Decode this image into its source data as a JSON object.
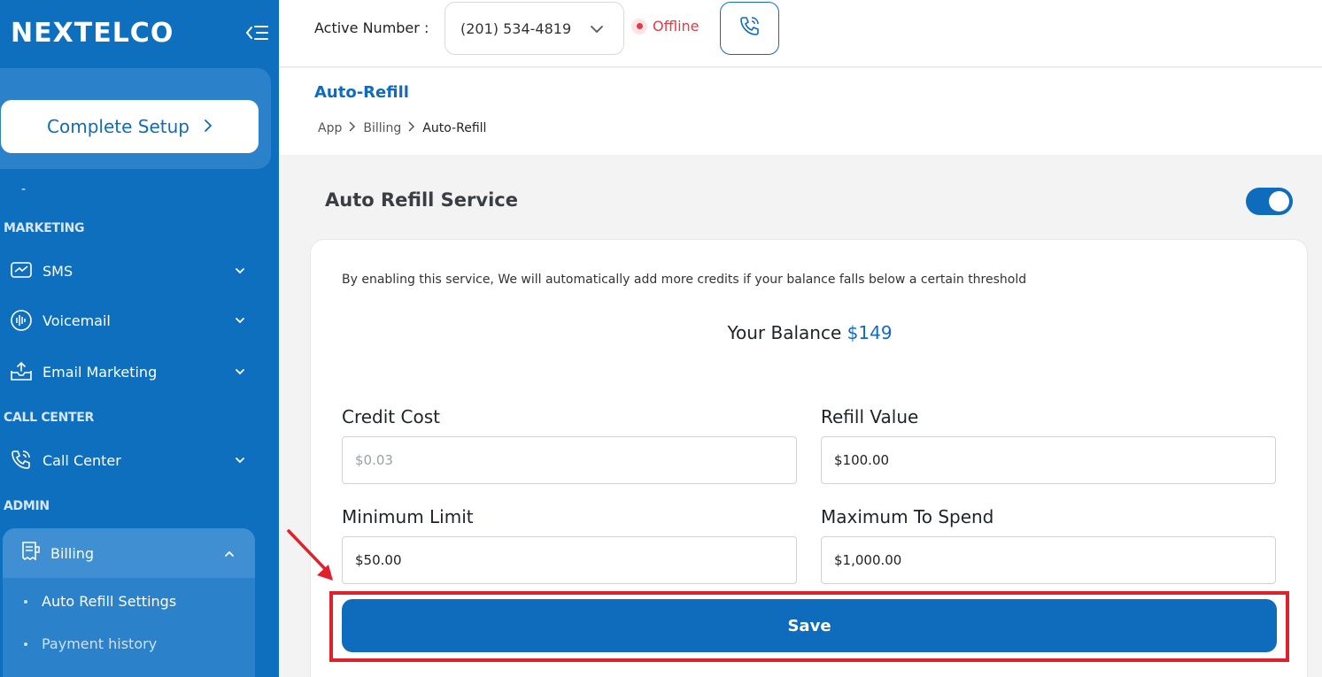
{
  "brand": {
    "logo_text": "NEXTELCO"
  },
  "sidebar": {
    "setup_button": "Complete Setup",
    "dash": "-",
    "sections": {
      "marketing": "MARKETING",
      "call_center": "CALL CENTER",
      "admin": "ADMIN"
    },
    "items": {
      "sms": "SMS",
      "voicemail": "Voicemail",
      "email_marketing": "Email Marketing",
      "call_center": "Call Center",
      "billing": "Billing"
    },
    "billing_sub": {
      "auto_refill": "Auto Refill Settings",
      "payment_history": "Payment history"
    }
  },
  "topbar": {
    "active_label": "Active Number :",
    "active_number": "(201) 534-4819",
    "status": "Offline"
  },
  "page": {
    "title": "Auto-Refill",
    "breadcrumb": [
      "App",
      "Billing",
      "Auto-Refill"
    ]
  },
  "service": {
    "title": "Auto Refill Service",
    "enabled": true,
    "description": "By enabling this service, We will automatically add more credits if your balance falls below a certain threshold",
    "balance_label": "Your Balance",
    "balance_value": "$149"
  },
  "form": {
    "credit_cost_label": "Credit Cost",
    "credit_cost_value": "$0.03",
    "refill_value_label": "Refill Value",
    "refill_value_value": "$100.00",
    "minimum_limit_label": "Minimum Limit",
    "minimum_limit_value": "$50.00",
    "maximum_spend_label": "Maximum To Spend",
    "maximum_spend_value": "$1,000.00",
    "save_label": "Save"
  },
  "colors": {
    "primary": "#0f6cbd",
    "sidebar": "#0f6fbf",
    "offline": "#e53945",
    "highlight": "#e0202a"
  }
}
